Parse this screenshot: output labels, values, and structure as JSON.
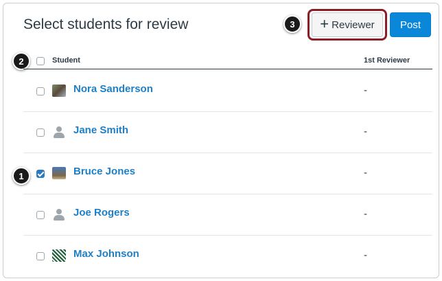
{
  "page_title": "Select students for review",
  "toolbar": {
    "reviewer_label": "Reviewer",
    "reviewer_icon": "plus-icon",
    "post_label": "Post",
    "post_color": "#0b87da",
    "highlight_color": "#8b1d26"
  },
  "table": {
    "headers": {
      "student": "Student",
      "reviewer": "1st Reviewer"
    },
    "rows": [
      {
        "name": "Nora Sanderson",
        "reviewer": "-",
        "checked": false,
        "avatar": "photo"
      },
      {
        "name": "Jane Smith",
        "reviewer": "-",
        "checked": false,
        "avatar": "default-person-icon"
      },
      {
        "name": "Bruce Jones",
        "reviewer": "-",
        "checked": true,
        "avatar": "photo"
      },
      {
        "name": "Joe Rogers",
        "reviewer": "-",
        "checked": false,
        "avatar": "default-person-icon"
      },
      {
        "name": "Max Johnson",
        "reviewer": "-",
        "checked": false,
        "avatar": "pattern"
      }
    ]
  },
  "callouts": [
    "1",
    "2",
    "3"
  ],
  "link_color": "#1e7fc6",
  "check_color": "#2a7abf"
}
